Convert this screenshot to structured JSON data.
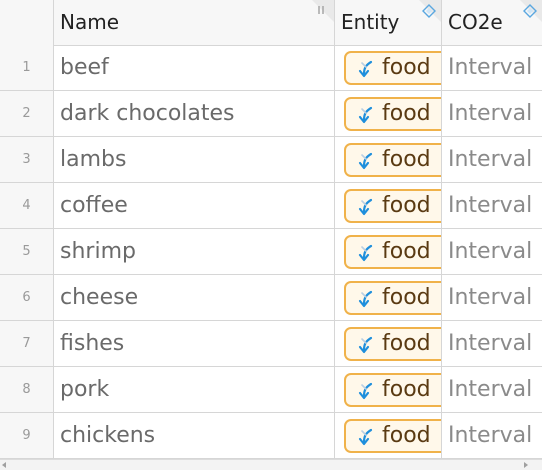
{
  "columns": {
    "name": {
      "label": "Name",
      "icon": "drag-handle-icon"
    },
    "entity": {
      "label": "Entity",
      "icon": "column-type-icon"
    },
    "co2e": {
      "label": "CO2e",
      "icon": "column-type-icon"
    }
  },
  "rows": [
    {
      "index": "1",
      "name": "beef",
      "entity": "food",
      "co2e": "Interval"
    },
    {
      "index": "2",
      "name": "dark chocolates",
      "entity": "food",
      "co2e": "Interval"
    },
    {
      "index": "3",
      "name": "lambs",
      "entity": "food",
      "co2e": "Interval"
    },
    {
      "index": "4",
      "name": "coffee",
      "entity": "food",
      "co2e": "Interval"
    },
    {
      "index": "5",
      "name": "shrimp",
      "entity": "food",
      "co2e": "Interval"
    },
    {
      "index": "6",
      "name": "cheese",
      "entity": "food",
      "co2e": "Interval"
    },
    {
      "index": "7",
      "name": "fishes",
      "entity": "food",
      "co2e": "Interval"
    },
    {
      "index": "8",
      "name": "pork",
      "entity": "food",
      "co2e": "Interval"
    },
    {
      "index": "9",
      "name": "chickens",
      "entity": "food",
      "co2e": "Interval"
    }
  ],
  "entity_chip": {
    "icon": "entity-arrow-icon",
    "border_color": "#f0b24a",
    "background": "#fff8ea",
    "icon_color": "#1f8fdc"
  }
}
